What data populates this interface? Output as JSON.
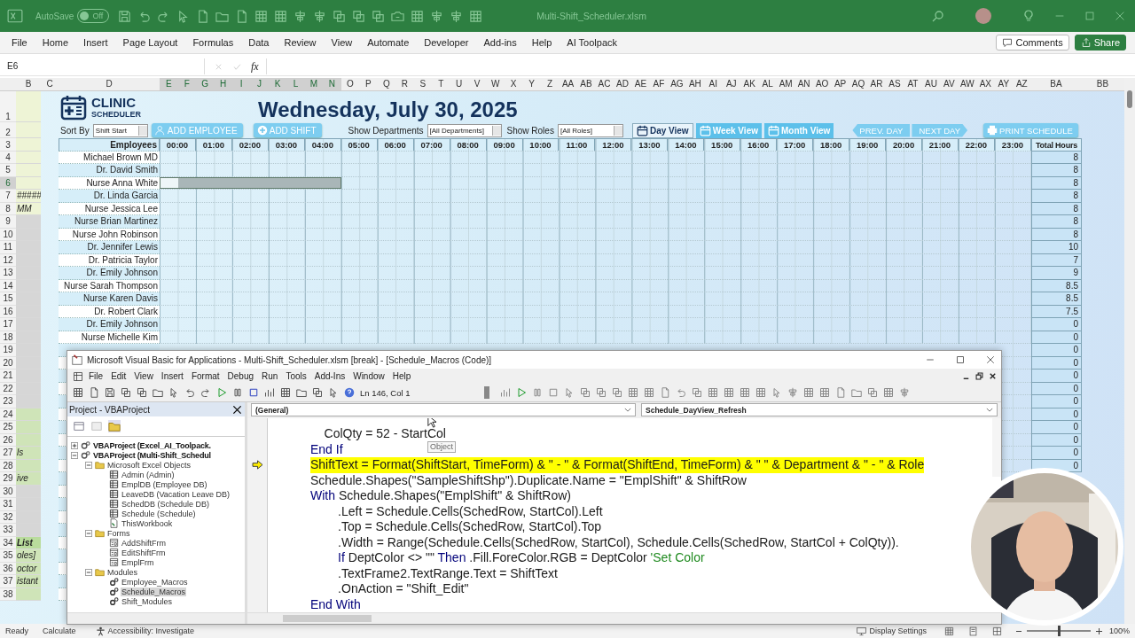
{
  "app": {
    "autosave_label": "AutoSave",
    "autosave": {
      "label": "Off",
      "on": false
    },
    "filename": "Multi-Shift_Scheduler.xlsm"
  },
  "ribbon_tabs": [
    "File",
    "Home",
    "Insert",
    "Page Layout",
    "Formulas",
    "Data",
    "Review",
    "View",
    "Automate",
    "Developer",
    "Add-ins",
    "Help",
    "AI Toolpack"
  ],
  "comments": "Comments",
  "share": "Share",
  "formula_bar": {
    "name_box": "E6",
    "fx": "fx"
  },
  "columns": [
    {
      "label": "B",
      "selected": false
    },
    {
      "label": "C",
      "selected": false
    },
    {
      "label": "D",
      "selected": false
    },
    {
      "label": "E",
      "selected": true
    },
    {
      "label": "F",
      "selected": true
    },
    {
      "label": "G",
      "selected": true
    },
    {
      "label": "H",
      "selected": true
    },
    {
      "label": "I",
      "selected": true
    },
    {
      "label": "J",
      "selected": true
    },
    {
      "label": "K",
      "selected": true
    },
    {
      "label": "L",
      "selected": true
    },
    {
      "label": "M",
      "selected": true
    },
    {
      "label": "N",
      "selected": true
    },
    {
      "label": "O",
      "selected": false
    },
    {
      "label": "P",
      "selected": false
    },
    {
      "label": "Q",
      "selected": false
    },
    {
      "label": "R",
      "selected": false
    },
    {
      "label": "S",
      "selected": false
    },
    {
      "label": "T",
      "selected": false
    },
    {
      "label": "U",
      "selected": false
    },
    {
      "label": "V",
      "selected": false
    },
    {
      "label": "W",
      "selected": false
    },
    {
      "label": "X",
      "selected": false
    },
    {
      "label": "Y",
      "selected": false
    },
    {
      "label": "Z",
      "selected": false
    },
    {
      "label": "AA",
      "selected": false
    },
    {
      "label": "AB",
      "selected": false
    },
    {
      "label": "AC",
      "selected": false
    },
    {
      "label": "AD",
      "selected": false
    },
    {
      "label": "AE",
      "selected": false
    },
    {
      "label": "AF",
      "selected": false
    },
    {
      "label": "AG",
      "selected": false
    },
    {
      "label": "AH",
      "selected": false
    },
    {
      "label": "AI",
      "selected": false
    },
    {
      "label": "AJ",
      "selected": false
    },
    {
      "label": "AK",
      "selected": false
    },
    {
      "label": "AL",
      "selected": false
    },
    {
      "label": "AM",
      "selected": false
    },
    {
      "label": "AN",
      "selected": false
    },
    {
      "label": "AO",
      "selected": false
    },
    {
      "label": "AP",
      "selected": false
    },
    {
      "label": "AQ",
      "selected": false
    },
    {
      "label": "AR",
      "selected": false
    },
    {
      "label": "AS",
      "selected": false
    },
    {
      "label": "AT",
      "selected": false
    },
    {
      "label": "AU",
      "selected": false
    },
    {
      "label": "AV",
      "selected": false
    },
    {
      "label": "AW",
      "selected": false
    },
    {
      "label": "AX",
      "selected": false
    },
    {
      "label": "AY",
      "selected": false
    },
    {
      "label": "AZ",
      "selected": false
    },
    {
      "label": "BA",
      "selected": false
    },
    {
      "label": "BB",
      "selected": false
    }
  ],
  "header_rows": [
    "1",
    "2"
  ],
  "header": {
    "logo_title": "CLINIC",
    "logo_subtitle": "SCHEDULER",
    "date": "Wednesday, July 30, 2025",
    "sort_label": "Sort By",
    "sort_value": "Shift Start",
    "add_employee": "ADD EMPLOYEE",
    "add_shift": "ADD SHIFT",
    "dept_label": "Show Departments",
    "dept_value": "[All Departments]",
    "roles_label": "Show Roles",
    "roles_value": "[All Roles]",
    "views": [
      {
        "label": "Day View",
        "selected": true
      },
      {
        "label": "Week View",
        "selected": false
      },
      {
        "label": "Month View",
        "selected": false
      }
    ],
    "prev": "PREV. DAY",
    "next": "NEXT DAY",
    "print": "PRINT SCHEDULE"
  },
  "grid": {
    "num": "3",
    "employees_heading": "Employees",
    "hours": [
      "00:00",
      "01:00",
      "02:00",
      "03:00",
      "04:00",
      "05:00",
      "06:00",
      "07:00",
      "08:00",
      "09:00",
      "10:00",
      "11:00",
      "12:00",
      "13:00",
      "14:00",
      "15:00",
      "16:00",
      "17:00",
      "18:00",
      "19:00",
      "20:00",
      "21:00",
      "22:00",
      "23:00"
    ],
    "total_heading": "Total Hours"
  },
  "rows": [
    {
      "num": "4",
      "selected": false,
      "b": {
        "kind": "note"
      },
      "name": "Michael Brown MD",
      "total": "8"
    },
    {
      "num": "5",
      "selected": false,
      "b": {
        "kind": "note"
      },
      "name": "Dr. David Smith",
      "total": "8"
    },
    {
      "num": "6",
      "selected": true,
      "b": {
        "kind": "note"
      },
      "name": "Nurse Anna White",
      "total": "8"
    },
    {
      "num": "7",
      "selected": false,
      "b": {
        "kind": "note",
        "text": "#####"
      },
      "name": "Dr. Linda Garcia",
      "total": "8"
    },
    {
      "num": "8",
      "selected": false,
      "b": {
        "kind": "note",
        "text": "MM"
      },
      "name": "Nurse Jessica Lee",
      "total": "8"
    },
    {
      "num": "9",
      "selected": false,
      "b": {
        "kind": "blank"
      },
      "name": "Nurse Brian Martinez",
      "total": "8"
    },
    {
      "num": "10",
      "selected": false,
      "b": {
        "kind": "blank"
      },
      "name": "Nurse John Robinson",
      "total": "8"
    },
    {
      "num": "11",
      "selected": false,
      "b": {
        "kind": "blank"
      },
      "name": "Dr. Jennifer Lewis",
      "total": "10"
    },
    {
      "num": "12",
      "selected": false,
      "b": {
        "kind": "blank"
      },
      "name": "Dr. Patricia Taylor",
      "total": "7"
    },
    {
      "num": "13",
      "selected": false,
      "b": {
        "kind": "blank"
      },
      "name": "Dr. Emily Johnson",
      "total": "9"
    },
    {
      "num": "14",
      "selected": false,
      "b": {
        "kind": "blank"
      },
      "name": "Nurse Sarah Thompson",
      "total": "8.5"
    },
    {
      "num": "15",
      "selected": false,
      "b": {
        "kind": "blank"
      },
      "name": "Nurse Karen Davis",
      "total": "8.5"
    },
    {
      "num": "16",
      "selected": false,
      "b": {
        "kind": "blank"
      },
      "name": "Dr. Robert Clark",
      "total": "7.5"
    },
    {
      "num": "17",
      "selected": false,
      "b": {
        "kind": "blank"
      },
      "name": "Dr. Emily Johnson",
      "total": "0"
    },
    {
      "num": "18",
      "selected": false,
      "b": {
        "kind": "blank"
      },
      "name": "Nurse Michelle Kim",
      "total": "0"
    },
    {
      "num": "19",
      "selected": false,
      "b": {
        "kind": "blank"
      },
      "total": "0"
    },
    {
      "num": "20",
      "selected": false,
      "b": {
        "kind": "blank"
      },
      "total": "0"
    },
    {
      "num": "21",
      "selected": false,
      "b": {
        "kind": "blank"
      },
      "total": "0"
    },
    {
      "num": "22",
      "selected": false,
      "b": {
        "kind": "blank"
      },
      "total": "0"
    },
    {
      "num": "23",
      "selected": false,
      "b": {
        "kind": "blank"
      },
      "total": "0"
    },
    {
      "num": "24",
      "selected": false,
      "b": {
        "kind": "tag"
      },
      "total": "0"
    },
    {
      "num": "25",
      "selected": false,
      "b": {
        "kind": "tag"
      },
      "total": "0"
    },
    {
      "num": "26",
      "selected": false,
      "b": {
        "kind": "tag"
      },
      "total": "0"
    },
    {
      "num": "27",
      "selected": false,
      "b": {
        "kind": "tag",
        "text": "ls"
      },
      "total": "0"
    },
    {
      "num": "28",
      "selected": false,
      "b": {
        "kind": "tag"
      },
      "total": "0"
    },
    {
      "num": "29",
      "selected": false,
      "b": {
        "kind": "tag",
        "text": "ive"
      }
    },
    {
      "num": "30",
      "selected": false,
      "b": {
        "kind": "blank"
      }
    },
    {
      "num": "31",
      "selected": false,
      "b": {
        "kind": "blank"
      }
    },
    {
      "num": "32",
      "selected": false,
      "b": {
        "kind": "blank"
      }
    },
    {
      "num": "33",
      "selected": false,
      "b": {
        "kind": "blank"
      }
    },
    {
      "num": "34",
      "selected": false,
      "b": {
        "kind": "heading",
        "text": "List"
      }
    },
    {
      "num": "35",
      "selected": false,
      "b": {
        "kind": "tag",
        "text": "oles]"
      }
    },
    {
      "num": "36",
      "selected": false,
      "b": {
        "kind": "tag",
        "text": "octor"
      }
    },
    {
      "num": "37",
      "selected": false,
      "b": {
        "kind": "tag",
        "text": "istant"
      }
    },
    {
      "num": "38",
      "selected": false,
      "b": {
        "kind": "tag"
      }
    }
  ],
  "vba": {
    "title": "Microsoft Visual Basic for Applications - Multi-Shift_Scheduler.xlsm [break] - [Schedule_Macros (Code)]",
    "menu": [
      "File",
      "Edit",
      "View",
      "Insert",
      "Format",
      "Debug",
      "Run",
      "Tools",
      "Add-Ins",
      "Window",
      "Help"
    ],
    "position": "Ln 146, Col 1",
    "project_title": "Project - VBAProject",
    "project_tree": [
      {
        "label": "VBAProject (Excel_AI_Toolpack.",
        "kind": "project",
        "expanded": false,
        "selected": false
      },
      {
        "label": "VBAProject (Multi-Shift_Schedul",
        "kind": "project",
        "expanded": true,
        "selected": false,
        "children": [
          {
            "label": "Microsoft Excel Objects",
            "kind": "folder",
            "expanded": true,
            "selected": false,
            "children": [
              {
                "label": "Admin (Admin)",
                "kind": "sheet",
                "selected": false
              },
              {
                "label": "EmplDB (Employee DB)",
                "kind": "sheet",
                "selected": false
              },
              {
                "label": "LeaveDB (Vacation Leave DB)",
                "kind": "sheet",
                "selected": false
              },
              {
                "label": "SchedDB (Schedule DB)",
                "kind": "sheet",
                "selected": false
              },
              {
                "label": "Schedule (Schedule)",
                "kind": "sheet",
                "selected": false
              },
              {
                "label": "ThisWorkbook",
                "kind": "workbook",
                "selected": false
              }
            ]
          },
          {
            "label": "Forms",
            "kind": "folder",
            "expanded": true,
            "selected": false,
            "children": [
              {
                "label": "AddShiftFrm",
                "kind": "form",
                "selected": false
              },
              {
                "label": "EditShiftFrm",
                "kind": "form",
                "selected": false
              },
              {
                "label": "EmplFrm",
                "kind": "form",
                "selected": false
              }
            ]
          },
          {
            "label": "Modules",
            "kind": "folder",
            "expanded": true,
            "selected": false,
            "children": [
              {
                "label": "Employee_Macros",
                "kind": "module",
                "selected": false
              },
              {
                "label": "Schedule_Macros",
                "kind": "module",
                "selected": true
              },
              {
                "label": "Shift_Modules",
                "kind": "module",
                "selected": false
              }
            ]
          }
        ]
      }
    ],
    "object_box": "(General)",
    "procedure_box": "Schedule_DayView_Refresh",
    "tooltip": "Object",
    "code_lines": [
      {
        "current": false,
        "tokens": [
          {
            "text": "    ColQty = 52 - StartCol",
            "kind": "code"
          }
        ]
      },
      {
        "current": false,
        "tokens": [
          {
            "text": "End If",
            "kind": "keyword"
          }
        ]
      },
      {
        "current": true,
        "tokens": [
          {
            "text": "ShiftText = Format(ShiftStart, TimeForm) & \" - \" & Format(ShiftEnd, TimeForm) & \" \" & Department & \" - \" & Role",
            "kind": "code"
          }
        ]
      },
      {
        "current": false,
        "tokens": [
          {
            "text": "Schedule.Shapes(\"SampleShiftShp\").Duplicate.Name = \"EmplShift\" & ShiftRow",
            "kind": "code"
          }
        ]
      },
      {
        "current": false,
        "tokens": [
          {
            "text": "With",
            "kind": "keyword"
          },
          {
            "text": " Schedule.Shapes(\"EmplShift\" & ShiftRow)",
            "kind": "code"
          }
        ]
      },
      {
        "current": false,
        "tokens": [
          {
            "text": "        .Left = Schedule.Cells(SchedRow, StartCol).Left",
            "kind": "code"
          }
        ]
      },
      {
        "current": false,
        "tokens": [
          {
            "text": "        .Top = Schedule.Cells(SchedRow, StartCol).Top",
            "kind": "code"
          }
        ]
      },
      {
        "current": false,
        "tokens": [
          {
            "text": "        .Width = Range(Schedule.Cells(SchedRow, StartCol), Schedule.Cells(SchedRow, StartCol + ColQty)).",
            "kind": "code"
          }
        ]
      },
      {
        "current": false,
        "tokens": [
          {
            "text": "        If",
            "kind": "keyword"
          },
          {
            "text": " DeptColor <> \"\" ",
            "kind": "code"
          },
          {
            "text": "Then",
            "kind": "keyword"
          },
          {
            "text": " .Fill.ForeColor.RGB = DeptColor ",
            "kind": "code"
          },
          {
            "text": "'Set Color",
            "kind": "comment"
          }
        ]
      },
      {
        "current": false,
        "tokens": [
          {
            "text": "        .TextFrame2.TextRange.Text = ShiftText",
            "kind": "code"
          }
        ]
      },
      {
        "current": false,
        "tokens": [
          {
            "text": "        .OnAction = \"Shift_Edit\"",
            "kind": "code"
          }
        ]
      },
      {
        "current": false,
        "tokens": [
          {
            "text": "End With",
            "kind": "keyword"
          }
        ]
      }
    ]
  },
  "status": {
    "ready": "Ready",
    "calculate": "Calculate",
    "accessibility": "Accessibility: Investigate",
    "display_settings": "Display Settings",
    "zoom": {
      "level": 0.5,
      "label": "100%"
    }
  }
}
